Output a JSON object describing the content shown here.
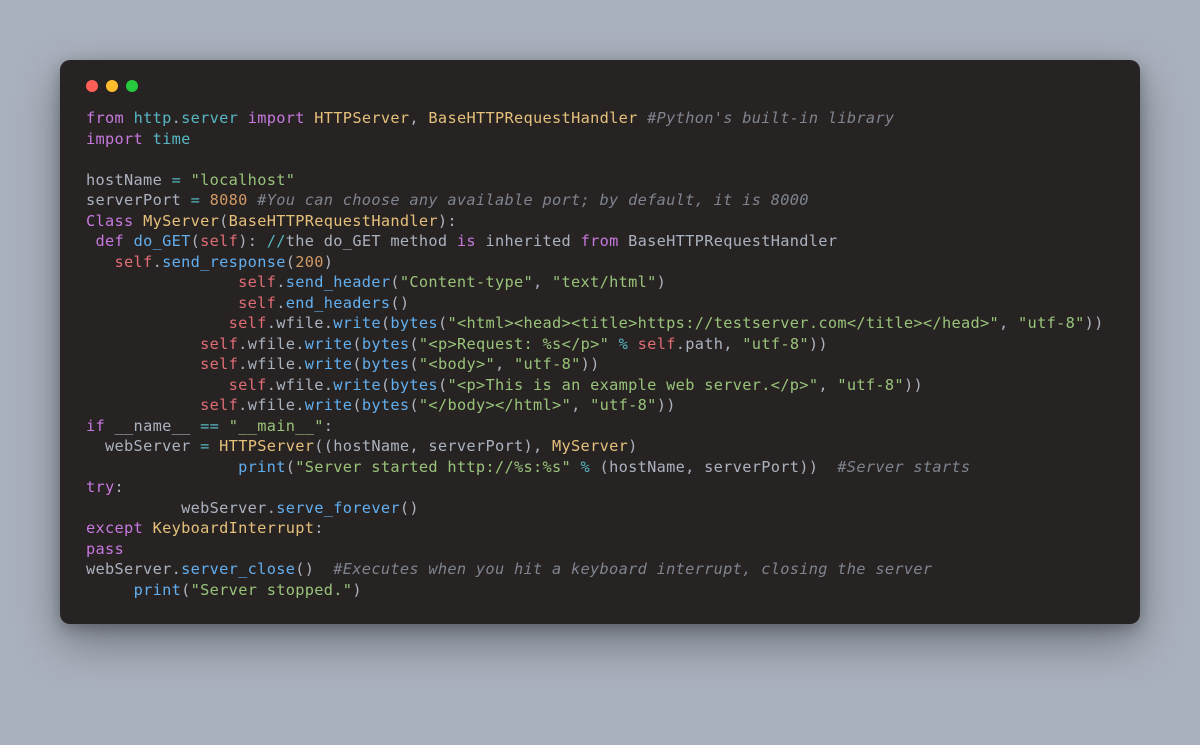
{
  "colors": {
    "page_bg": "#aab1be",
    "window_bg": "#272323",
    "red": "#ff5f56",
    "yellow": "#ffbd2e",
    "green": "#27c93f",
    "keyword": "#c678dd",
    "module": "#56b6c2",
    "class": "#e5c07b",
    "function": "#61afef",
    "variable": "#e06c75",
    "string": "#98c379",
    "number": "#d19a66",
    "comment": "#7f848e",
    "punct": "#abb2bf"
  },
  "code": {
    "lines": [
      [
        {
          "cls": "kw",
          "t": "from"
        },
        {
          "cls": "txt",
          "t": " "
        },
        {
          "cls": "mod",
          "t": "http"
        },
        {
          "cls": "pun",
          "t": "."
        },
        {
          "cls": "mod",
          "t": "server"
        },
        {
          "cls": "txt",
          "t": " "
        },
        {
          "cls": "kw",
          "t": "import"
        },
        {
          "cls": "txt",
          "t": " "
        },
        {
          "cls": "cls",
          "t": "HTTPServer"
        },
        {
          "cls": "pun",
          "t": ", "
        },
        {
          "cls": "cls",
          "t": "BaseHTTPRequestHandler"
        },
        {
          "cls": "txt",
          "t": " "
        },
        {
          "cls": "cmt",
          "t": "#Python's built-in library"
        }
      ],
      [
        {
          "cls": "kw",
          "t": "import"
        },
        {
          "cls": "txt",
          "t": " "
        },
        {
          "cls": "mod",
          "t": "time"
        }
      ],
      [],
      [
        {
          "cls": "txt",
          "t": "hostName "
        },
        {
          "cls": "op",
          "t": "="
        },
        {
          "cls": "txt",
          "t": " "
        },
        {
          "cls": "str",
          "t": "\"localhost\""
        }
      ],
      [
        {
          "cls": "txt",
          "t": "serverPort "
        },
        {
          "cls": "op",
          "t": "="
        },
        {
          "cls": "txt",
          "t": " "
        },
        {
          "cls": "num",
          "t": "8080"
        },
        {
          "cls": "txt",
          "t": " "
        },
        {
          "cls": "cmt",
          "t": "#You can choose any available port; by default, it is 8000"
        }
      ],
      [
        {
          "cls": "kw",
          "t": "Class"
        },
        {
          "cls": "txt",
          "t": " "
        },
        {
          "cls": "cls",
          "t": "MyServer"
        },
        {
          "cls": "pun",
          "t": "("
        },
        {
          "cls": "cls",
          "t": "BaseHTTPRequestHandler"
        },
        {
          "cls": "pun",
          "t": "):"
        }
      ],
      [
        {
          "cls": "txt",
          "t": " "
        },
        {
          "cls": "kw",
          "t": "def"
        },
        {
          "cls": "txt",
          "t": " "
        },
        {
          "cls": "fn",
          "t": "do_GET"
        },
        {
          "cls": "pun",
          "t": "("
        },
        {
          "cls": "var",
          "t": "self"
        },
        {
          "cls": "pun",
          "t": "): "
        },
        {
          "cls": "op",
          "t": "//"
        },
        {
          "cls": "txt",
          "t": "the do_GET method "
        },
        {
          "cls": "kw",
          "t": "is"
        },
        {
          "cls": "txt",
          "t": " inherited "
        },
        {
          "cls": "kw",
          "t": "from"
        },
        {
          "cls": "txt",
          "t": " BaseHTTPRequestHandler"
        }
      ],
      [
        {
          "cls": "txt",
          "t": "   "
        },
        {
          "cls": "var",
          "t": "self"
        },
        {
          "cls": "pun",
          "t": "."
        },
        {
          "cls": "fn",
          "t": "send_response"
        },
        {
          "cls": "pun",
          "t": "("
        },
        {
          "cls": "num",
          "t": "200"
        },
        {
          "cls": "pun",
          "t": ")"
        }
      ],
      [
        {
          "cls": "txt",
          "t": "                "
        },
        {
          "cls": "var",
          "t": "self"
        },
        {
          "cls": "pun",
          "t": "."
        },
        {
          "cls": "fn",
          "t": "send_header"
        },
        {
          "cls": "pun",
          "t": "("
        },
        {
          "cls": "str",
          "t": "\"Content-type\""
        },
        {
          "cls": "pun",
          "t": ", "
        },
        {
          "cls": "str",
          "t": "\"text/html\""
        },
        {
          "cls": "pun",
          "t": ")"
        }
      ],
      [
        {
          "cls": "txt",
          "t": "                "
        },
        {
          "cls": "var",
          "t": "self"
        },
        {
          "cls": "pun",
          "t": "."
        },
        {
          "cls": "fn",
          "t": "end_headers"
        },
        {
          "cls": "pun",
          "t": "()"
        }
      ],
      [
        {
          "cls": "txt",
          "t": "               "
        },
        {
          "cls": "var",
          "t": "self"
        },
        {
          "cls": "pun",
          "t": "."
        },
        {
          "cls": "txt",
          "t": "wfile"
        },
        {
          "cls": "pun",
          "t": "."
        },
        {
          "cls": "fn",
          "t": "write"
        },
        {
          "cls": "pun",
          "t": "("
        },
        {
          "cls": "fn",
          "t": "bytes"
        },
        {
          "cls": "pun",
          "t": "("
        },
        {
          "cls": "str",
          "t": "\"<html><head><title>https://testserver.com</title></head>\""
        },
        {
          "cls": "pun",
          "t": ", "
        },
        {
          "cls": "str",
          "t": "\"utf-8\""
        },
        {
          "cls": "pun",
          "t": "))"
        }
      ],
      [
        {
          "cls": "txt",
          "t": "            "
        },
        {
          "cls": "var",
          "t": "self"
        },
        {
          "cls": "pun",
          "t": "."
        },
        {
          "cls": "txt",
          "t": "wfile"
        },
        {
          "cls": "pun",
          "t": "."
        },
        {
          "cls": "fn",
          "t": "write"
        },
        {
          "cls": "pun",
          "t": "("
        },
        {
          "cls": "fn",
          "t": "bytes"
        },
        {
          "cls": "pun",
          "t": "("
        },
        {
          "cls": "str",
          "t": "\"<p>Request: %s</p>\""
        },
        {
          "cls": "txt",
          "t": " "
        },
        {
          "cls": "op",
          "t": "%"
        },
        {
          "cls": "txt",
          "t": " "
        },
        {
          "cls": "var",
          "t": "self"
        },
        {
          "cls": "pun",
          "t": "."
        },
        {
          "cls": "txt",
          "t": "path, "
        },
        {
          "cls": "str",
          "t": "\"utf-8\""
        },
        {
          "cls": "pun",
          "t": "))"
        }
      ],
      [
        {
          "cls": "txt",
          "t": "            "
        },
        {
          "cls": "var",
          "t": "self"
        },
        {
          "cls": "pun",
          "t": "."
        },
        {
          "cls": "txt",
          "t": "wfile"
        },
        {
          "cls": "pun",
          "t": "."
        },
        {
          "cls": "fn",
          "t": "write"
        },
        {
          "cls": "pun",
          "t": "("
        },
        {
          "cls": "fn",
          "t": "bytes"
        },
        {
          "cls": "pun",
          "t": "("
        },
        {
          "cls": "str",
          "t": "\"<body>\""
        },
        {
          "cls": "pun",
          "t": ", "
        },
        {
          "cls": "str",
          "t": "\"utf-8\""
        },
        {
          "cls": "pun",
          "t": "))"
        }
      ],
      [
        {
          "cls": "txt",
          "t": "               "
        },
        {
          "cls": "var",
          "t": "self"
        },
        {
          "cls": "pun",
          "t": "."
        },
        {
          "cls": "txt",
          "t": "wfile"
        },
        {
          "cls": "pun",
          "t": "."
        },
        {
          "cls": "fn",
          "t": "write"
        },
        {
          "cls": "pun",
          "t": "("
        },
        {
          "cls": "fn",
          "t": "bytes"
        },
        {
          "cls": "pun",
          "t": "("
        },
        {
          "cls": "str",
          "t": "\"<p>This is an example web server.</p>\""
        },
        {
          "cls": "pun",
          "t": ", "
        },
        {
          "cls": "str",
          "t": "\"utf-8\""
        },
        {
          "cls": "pun",
          "t": "))"
        }
      ],
      [
        {
          "cls": "txt",
          "t": "            "
        },
        {
          "cls": "var",
          "t": "self"
        },
        {
          "cls": "pun",
          "t": "."
        },
        {
          "cls": "txt",
          "t": "wfile"
        },
        {
          "cls": "pun",
          "t": "."
        },
        {
          "cls": "fn",
          "t": "write"
        },
        {
          "cls": "pun",
          "t": "("
        },
        {
          "cls": "fn",
          "t": "bytes"
        },
        {
          "cls": "pun",
          "t": "("
        },
        {
          "cls": "str",
          "t": "\"</body></html>\""
        },
        {
          "cls": "pun",
          "t": ", "
        },
        {
          "cls": "str",
          "t": "\"utf-8\""
        },
        {
          "cls": "pun",
          "t": "))"
        }
      ],
      [
        {
          "cls": "kw",
          "t": "if"
        },
        {
          "cls": "txt",
          "t": " __name__ "
        },
        {
          "cls": "op",
          "t": "=="
        },
        {
          "cls": "txt",
          "t": " "
        },
        {
          "cls": "str",
          "t": "\"__main__\""
        },
        {
          "cls": "pun",
          "t": ":"
        }
      ],
      [
        {
          "cls": "txt",
          "t": "  webServer "
        },
        {
          "cls": "op",
          "t": "="
        },
        {
          "cls": "txt",
          "t": " "
        },
        {
          "cls": "cls",
          "t": "HTTPServer"
        },
        {
          "cls": "pun",
          "t": "((hostName, serverPort), "
        },
        {
          "cls": "cls",
          "t": "MyServer"
        },
        {
          "cls": "pun",
          "t": ")"
        }
      ],
      [
        {
          "cls": "txt",
          "t": "                "
        },
        {
          "cls": "fn",
          "t": "print"
        },
        {
          "cls": "pun",
          "t": "("
        },
        {
          "cls": "str",
          "t": "\"Server started http://%s:%s\""
        },
        {
          "cls": "txt",
          "t": " "
        },
        {
          "cls": "op",
          "t": "%"
        },
        {
          "cls": "txt",
          "t": " (hostName, serverPort))  "
        },
        {
          "cls": "cmt",
          "t": "#Server starts"
        }
      ],
      [
        {
          "cls": "kw",
          "t": "try"
        },
        {
          "cls": "pun",
          "t": ":"
        }
      ],
      [
        {
          "cls": "txt",
          "t": "          webServer."
        },
        {
          "cls": "fn",
          "t": "serve_forever"
        },
        {
          "cls": "pun",
          "t": "()"
        }
      ],
      [
        {
          "cls": "kw",
          "t": "except"
        },
        {
          "cls": "txt",
          "t": " "
        },
        {
          "cls": "cls",
          "t": "KeyboardInterrupt"
        },
        {
          "cls": "pun",
          "t": ":"
        }
      ],
      [
        {
          "cls": "kw",
          "t": "pass"
        }
      ],
      [
        {
          "cls": "txt",
          "t": "webServer."
        },
        {
          "cls": "fn",
          "t": "server_close"
        },
        {
          "cls": "pun",
          "t": "()  "
        },
        {
          "cls": "cmt",
          "t": "#Executes when you hit a keyboard interrupt, closing the server"
        }
      ],
      [
        {
          "cls": "txt",
          "t": "     "
        },
        {
          "cls": "fn",
          "t": "print"
        },
        {
          "cls": "pun",
          "t": "("
        },
        {
          "cls": "str",
          "t": "\"Server stopped.\""
        },
        {
          "cls": "pun",
          "t": ")"
        }
      ]
    ]
  }
}
